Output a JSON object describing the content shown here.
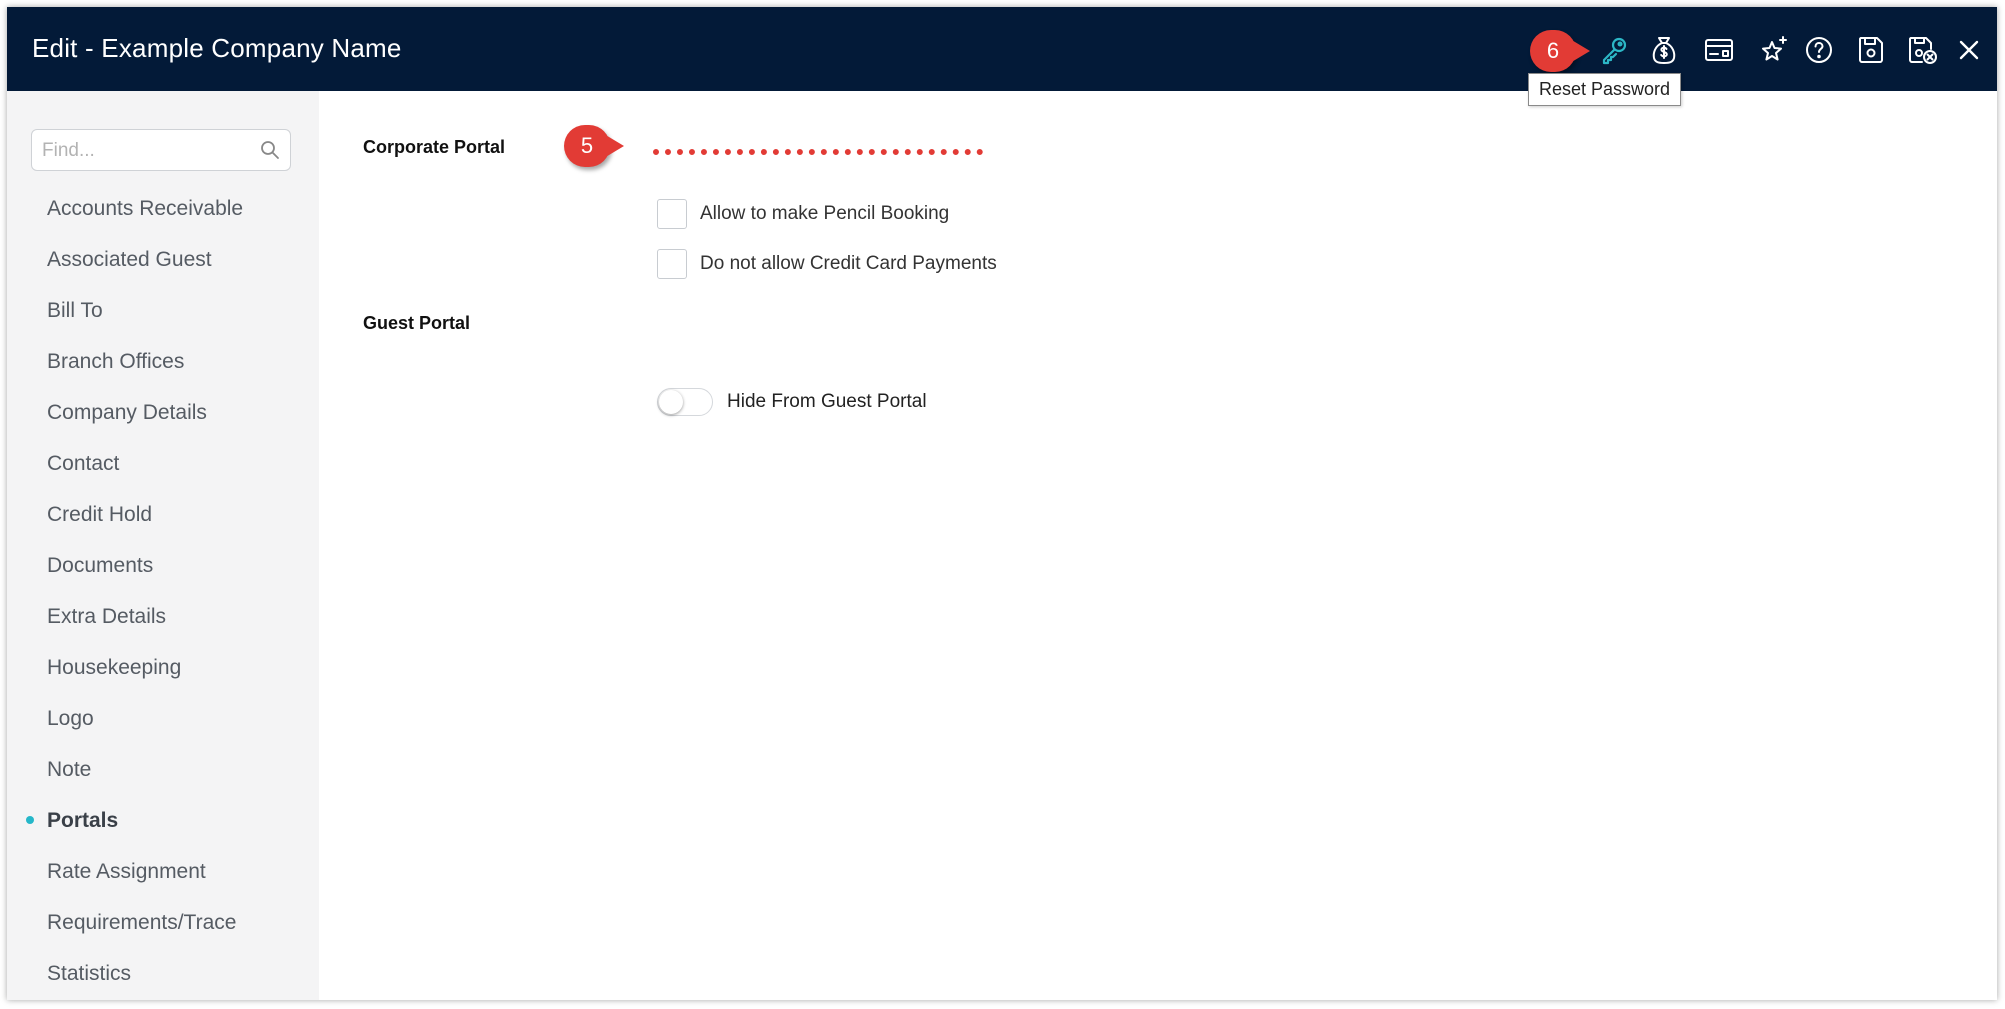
{
  "window": {
    "title": "Edit - Example Company Name"
  },
  "toolbar": {
    "icons": [
      "reset-password-icon",
      "money-bag-icon",
      "payment-card-icon",
      "sparkle-star-icon",
      "help-icon",
      "save-icon",
      "save-close-icon",
      "close-icon"
    ],
    "tooltip": "Reset Password",
    "accent_color": "#2cb7c6"
  },
  "callouts": {
    "five": "5",
    "six": "6",
    "color": "#e23b35"
  },
  "sidebar": {
    "search_placeholder": "Find...",
    "items": [
      "Accounts Receivable",
      "Associated Guest",
      "Bill To",
      "Branch Offices",
      "Company Details",
      "Contact",
      "Credit Hold",
      "Documents",
      "Extra Details",
      "Housekeeping",
      "Logo",
      "Note",
      "Portals",
      "Rate Assignment",
      "Requirements/Trace",
      "Statistics"
    ],
    "active_item": "Portals"
  },
  "main": {
    "corporate_portal": {
      "label": "Corporate Portal",
      "options": [
        {
          "label": "Allow to make Pencil Booking",
          "checked": false
        },
        {
          "label": "Do not allow Credit Card Payments",
          "checked": false
        }
      ]
    },
    "guest_portal": {
      "label": "Guest Portal",
      "toggle": {
        "label": "Hide From Guest Portal",
        "on": false
      }
    }
  }
}
